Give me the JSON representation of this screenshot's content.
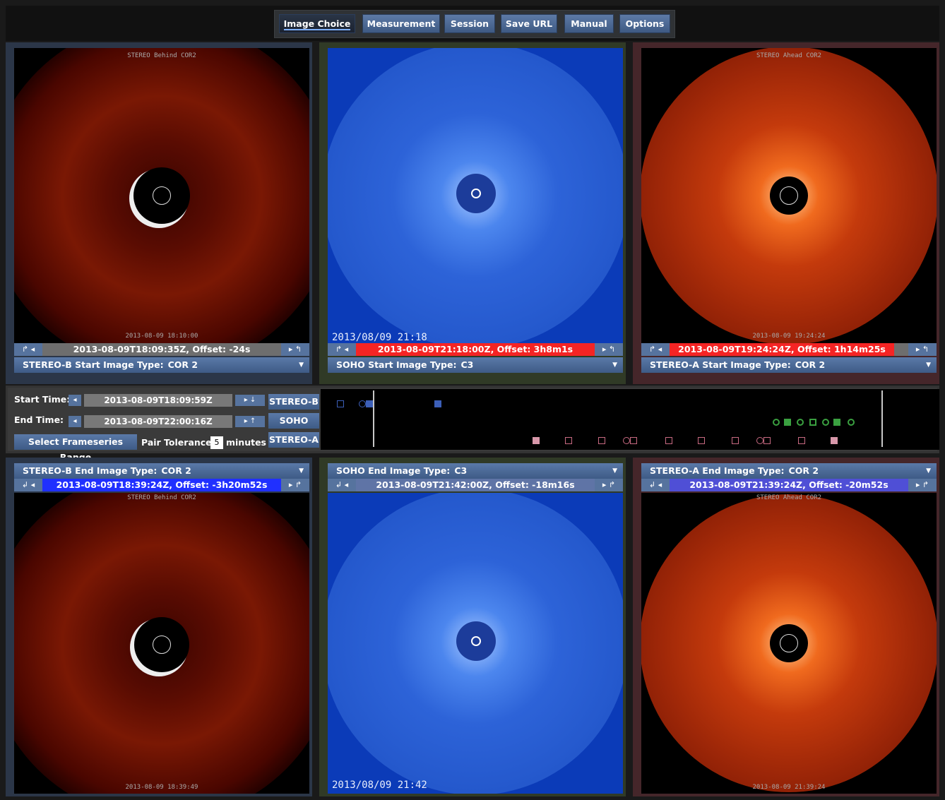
{
  "menu": [
    {
      "label": "Image Choice",
      "active": true
    },
    {
      "label": "Measurement"
    },
    {
      "label": "Session"
    },
    {
      "label": "Save URL"
    },
    {
      "label": "Manual"
    },
    {
      "label": "Options"
    }
  ],
  "colors": {
    "nav_blue": "#56739e",
    "time_red": "#ff2a2a",
    "time_blue": "#2030ff",
    "time_grey": "#6e6e6e",
    "stereo_b_marker": "#3c5fb8",
    "stereo_a_marker": "#c86a82",
    "soho_marker": "#3aa040"
  },
  "panels": {
    "stereo_b_start": {
      "image_title": "STEREO Behind COR2",
      "image_timestamp": "2013-08-09 18:10:00",
      "time_value": "2013-08-09T18:09:35Z, Offset: -24s",
      "type_label": "STEREO-B Start Image Type:",
      "type_value": "COR 2"
    },
    "soho_start": {
      "image_timestamp": "2013/08/09 21:18",
      "time_value": "2013-08-09T21:18:00Z, Offset: 3h8m1s",
      "type_label": "SOHO Start Image Type:",
      "type_value": "C3"
    },
    "stereo_a_start": {
      "image_title": "STEREO Ahead COR2",
      "image_timestamp": "2013-08-09 19:24:24",
      "time_value": "2013-08-09T19:24:24Z, Offset: 1h14m25s",
      "type_label": "STEREO-A Start Image Type:",
      "type_value": "COR 2"
    },
    "stereo_b_end": {
      "type_label": "STEREO-B End Image Type:",
      "type_value": "COR 2",
      "time_value": "2013-08-09T18:39:24Z, Offset: -3h20m52s",
      "image_title": "STEREO Behind COR2",
      "image_timestamp": "2013-08-09 18:39:49"
    },
    "soho_end": {
      "type_label": "SOHO End Image Type:",
      "type_value": "C3",
      "time_value": "2013-08-09T21:42:00Z, Offset: -18m16s",
      "image_timestamp": "2013/08/09 21:42"
    },
    "stereo_a_end": {
      "type_label": "STEREO-A End Image Type:",
      "type_value": "COR 2",
      "time_value": "2013-08-09T21:39:24Z, Offset: -20m52s",
      "image_title": "STEREO Ahead COR2",
      "image_timestamp": "2013-08-09 21:39:24"
    }
  },
  "controls": {
    "start_label": "Start Time:",
    "start_value": "2013-08-09T18:09:59Z",
    "end_label": "End Time:",
    "end_value": "2013-08-09T22:00:16Z",
    "range_button": "Select Frameseries Range",
    "tolerance_label": "Pair Tolerance:",
    "tolerance_value": "5",
    "tolerance_unit": "minutes",
    "sources": [
      "STEREO-B",
      "SOHO",
      "STEREO-A"
    ]
  }
}
